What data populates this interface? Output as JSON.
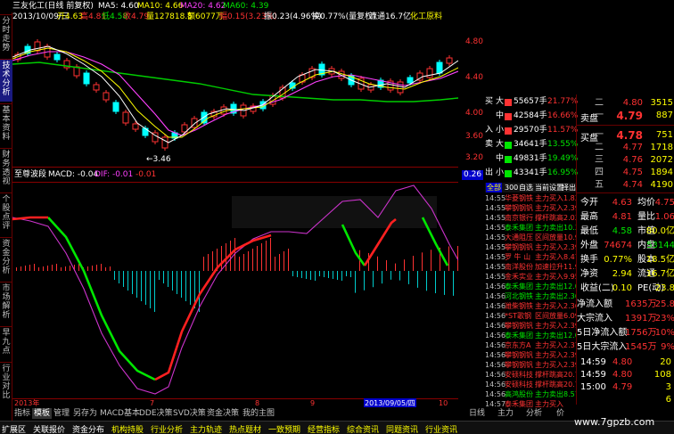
{
  "left_tabs": [
    "分时走势",
    "技术分析",
    "基本资料",
    "财务透视",
    "个股点评",
    "资金分析",
    "市场解析",
    "早九点",
    "行业对比"
  ],
  "stock": {
    "title": "三友化工(日线 前复权)",
    "ma5": "MA5: 4.60",
    "ma10": "MA10: 4.66",
    "ma20": "MA20: 4.62",
    "ma60": "MA60: 4.39",
    "info_line_1": "2013/10/09/三",
    "info_open": "开4.63",
    "info_high": "高4.81",
    "info_low": "低4.58",
    "info_close": "收4.79",
    "info_volume": "量127818.5",
    "info_amount": "额6077万",
    "info_change": "幅0.15(3.23%)",
    "info_amplitude": "振0.23(4.96%)",
    "info_turnover": "换0.77%(量复权)",
    "info_float": "流通16.7亿",
    "info_sector": "化工原料"
  },
  "price_axis": [
    "4.80",
    "4.40",
    "4.00",
    "3.60",
    "3.20"
  ],
  "low_marker": "3.46",
  "indicator": {
    "name": "至尊波段",
    "macd": "MACD: -0.04",
    "dif": "DIF: -0.01",
    "dea": "-0.01",
    "axis_top": "0.26"
  },
  "dates": [
    "2013年",
    "7",
    "8",
    "9",
    "2013/09/05/四",
    "10"
  ],
  "bottom_tabs": [
    "指标",
    "模板",
    "管理",
    "另存为",
    "MACD基本",
    "DDE决策",
    "SVD决策",
    "资金决策",
    "我的主图"
  ],
  "status_items": [
    "扩展区",
    "关联报价",
    "资金分布",
    "机构持股",
    "行业分析",
    "主力轨迹",
    "热点题材",
    "一致预期",
    "经营指标",
    "综合资讯",
    "同题资讯",
    "行业资讯"
  ],
  "watermark": "www.7gpzb.com",
  "order_book": [
    {
      "label": "买",
      "sub": "大",
      "value": "55657手",
      "pct": "21.77%",
      "color": "#ff3232"
    },
    {
      "label": "",
      "sub": "中",
      "value": "42584手",
      "pct": "16.66%",
      "color": "#ff3232"
    },
    {
      "label": "入",
      "sub": "小",
      "value": "29570手",
      "pct": "11.57%",
      "color": "#ff3232"
    },
    {
      "label": "卖",
      "sub": "大",
      "value": "34641手",
      "pct": "13.55%",
      "color": "#00e600"
    },
    {
      "label": "",
      "sub": "中",
      "value": "49831手",
      "pct": "19.49%",
      "color": "#00e600"
    },
    {
      "label": "出",
      "sub": "小",
      "value": "43341手",
      "pct": "16.95%",
      "color": "#00e600"
    }
  ],
  "ticks_header": [
    "全部",
    "300",
    "自选",
    "当前",
    "设置",
    "择出",
    "扩"
  ],
  "ticks": [
    {
      "time": "14:55",
      "name": "华菱钢铁",
      "action": "主力买入",
      "vol": "1.83/43",
      "color": "red"
    },
    {
      "time": "14:55",
      "name": "攀钢钢钒",
      "action": "主力买入",
      "vol": "2.39/6",
      "color": "red"
    },
    {
      "time": "14:55",
      "name": "南京银行",
      "action": "撑杆跳高",
      "vol": "2.03/62",
      "color": "red"
    },
    {
      "time": "14:55",
      "name": "泰禾集团",
      "action": "主力卖出",
      "vol": "10.38/1",
      "color": "green"
    },
    {
      "time": "14:55",
      "name": "大通阻压",
      "action": "区间放量",
      "vol": "10.93/1",
      "color": "red"
    },
    {
      "time": "14:55",
      "name": "攀钢钢钒",
      "action": "主力买入",
      "vol": "2.39/6",
      "color": "red"
    },
    {
      "time": "14:55",
      "name": "罗 牛 山",
      "action": "主力买入",
      "vol": "8.47/3",
      "color": "red"
    },
    {
      "time": "14:55",
      "name": "南洋股份",
      "action": "加速拉升",
      "vol": "11.95/",
      "color": "red"
    },
    {
      "time": "14:55",
      "name": "金禾实业",
      "action": "主力买入",
      "vol": "9.95/18",
      "color": "red"
    },
    {
      "time": "14:56",
      "name": "泰禾集团",
      "action": "主力卖出",
      "vol": "12.00/0",
      "color": "green"
    },
    {
      "time": "14:56",
      "name": "河北钢铁",
      "action": "主力卖出",
      "vol": "2.36/10",
      "color": "green"
    },
    {
      "time": "14:56",
      "name": "潍柴钢铁",
      "action": "主力买入",
      "vol": "2.36/8",
      "color": "red"
    },
    {
      "time": "14:56",
      "name": "*ST歌钢",
      "action": "区间放量",
      "vol": "6.09/6",
      "color": "red"
    },
    {
      "time": "14:56",
      "name": "攀钢钢钒",
      "action": "主力买入",
      "vol": "2.39/3",
      "color": "red"
    },
    {
      "time": "14:56",
      "name": "泰禾集团",
      "action": "主力卖出",
      "vol": "12.00/7",
      "color": "green"
    },
    {
      "time": "14:56",
      "name": "京东方A",
      "action": "主力买入",
      "vol": "2.37/10",
      "color": "red"
    },
    {
      "time": "14:56",
      "name": "攀钢钢钒",
      "action": "主力买入",
      "vol": "2.39/",
      "color": "red"
    },
    {
      "time": "14:56",
      "name": "攀钢钢钒",
      "action": "主力买入",
      "vol": "2.39/",
      "color": "red"
    },
    {
      "time": "14:56",
      "name": "安硕科技",
      "action": "撑杆跳高",
      "vol": "20.75/",
      "color": "red"
    },
    {
      "time": "14:56",
      "name": "安硕科技",
      "action": "撑杆跳高",
      "vol": "20.75/",
      "color": "red"
    },
    {
      "time": "14:56",
      "name": "高鸿股份",
      "action": "主力卖出",
      "vol": "8.57/",
      "color": "green"
    },
    {
      "time": "14:57",
      "name": "泰禾集团",
      "action": "主力买入",
      "vol": "",
      "color": "red"
    }
  ],
  "quote": {
    "sell_levels": [
      {
        "label": "二",
        "price": "4.80",
        "vol": "3515"
      },
      {
        "label": "一",
        "price": "4.79",
        "vol": "887"
      }
    ],
    "sell_label": "卖盘",
    "buy_label": "买盘",
    "buy_levels": [
      {
        "label": "一",
        "price": "4.78",
        "vol": "751"
      },
      {
        "label": "二",
        "price": "4.77",
        "vol": "1718"
      },
      {
        "label": "三",
        "price": "4.76",
        "vol": "2072"
      },
      {
        "label": "四",
        "price": "4.75",
        "vol": "1894"
      },
      {
        "label": "五",
        "price": "4.74",
        "vol": "4190"
      }
    ],
    "stats": [
      {
        "l1": "今开",
        "v1": "4.63",
        "c1": "red",
        "l2": "均价",
        "v2": "4.75",
        "c2": "red"
      },
      {
        "l1": "最高",
        "v1": "4.81",
        "c1": "red",
        "l2": "量比",
        "v2": "1.06",
        "c2": "red"
      },
      {
        "l1": "最低",
        "v1": "4.58",
        "c1": "green",
        "l2": "市值",
        "v2": "80.0亿",
        "c2": "yellow"
      },
      {
        "l1": "外盘",
        "v1": "74674",
        "c1": "red",
        "l2": "内盘",
        "v2": "53144",
        "c2": "green"
      },
      {
        "l1": "换手",
        "v1": "0.77%",
        "c1": "yellow",
        "l2": "股本",
        "v2": "18.5亿",
        "c2": "yellow"
      },
      {
        "l1": "净资",
        "v1": "2.94",
        "c1": "yellow",
        "l2": "流通",
        "v2": "16.7亿",
        "c2": "yellow"
      },
      {
        "l1": "收益(二)",
        "v1": "0.10",
        "c1": "yellow",
        "l2": "PE(动)",
        "v2": "23.8",
        "c2": "yellow"
      }
    ],
    "flows": [
      {
        "label": "净流入额",
        "value": "1635万",
        "val2": "25.8",
        "color": "red"
      },
      {
        "label": "大宗流入",
        "value": "1391万",
        "val2": "23%",
        "color": "red"
      },
      {
        "label": "5日净流入额",
        "value": "1756万",
        "val2": "10%",
        "color": "red"
      },
      {
        "label": "5日大宗流入",
        "value": "1545万",
        "val2": "9%",
        "color": "red"
      }
    ],
    "trades": [
      {
        "time": "14:59",
        "price": "4.80",
        "vol": "20"
      },
      {
        "time": "14:59",
        "price": "4.80",
        "vol": "108"
      },
      {
        "time": "15:00",
        "price": "4.79",
        "vol": "3"
      },
      {
        "time": "",
        "price": "",
        "vol": "6"
      }
    ]
  },
  "right_bottom_tabs": [
    "日线",
    "主力",
    "分析",
    "价"
  ]
}
